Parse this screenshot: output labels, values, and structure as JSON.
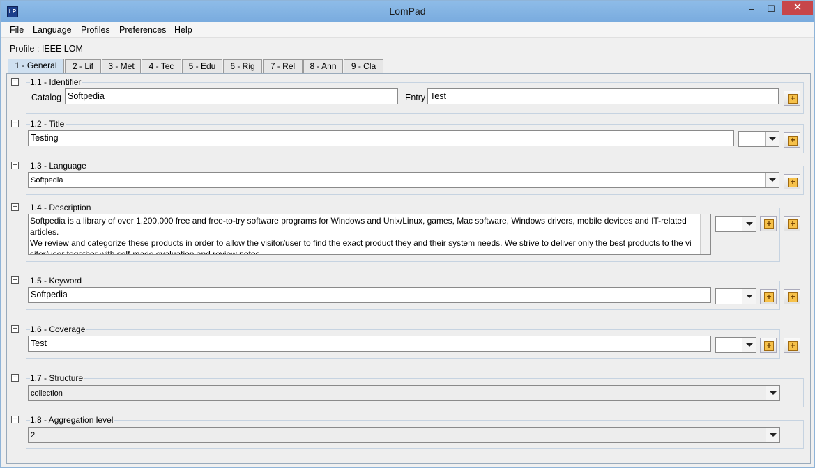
{
  "window": {
    "title": "LomPad",
    "icon": "app-logo-icon"
  },
  "menu": [
    "File",
    "Language",
    "Profiles",
    "Preferences",
    "Help"
  ],
  "profile": "Profile : IEEE LOM",
  "tabs": [
    "1 - General",
    "2 - Lif",
    "3 - Met",
    "4 - Tec",
    "5 - Edu",
    "6 - Rig",
    "7 - Rel",
    "8 - Ann",
    "9 - Cla"
  ],
  "sections": {
    "identifier": {
      "legend": "1.1 - Identifier",
      "catalog_label": "Catalog",
      "catalog_value": "Softpedia",
      "entry_label": "Entry",
      "entry_value": "Test"
    },
    "title": {
      "legend": "1.2 - Title",
      "value": "Testing"
    },
    "language": {
      "legend": "1.3 - Language",
      "value": "Softpedia"
    },
    "description": {
      "legend": "1.4 - Description",
      "line1": "Softpedia is a library of over 1,200,000 free and free-to-try software programs for Windows and Unix/Linux, games, Mac software, Windows drivers, mobile devices and IT-related",
      "line2": " articles.",
      "line3": "We review and categorize these products in order to allow the visitor/user to find the exact product they and their system needs. We strive to deliver only the best products to the vi",
      "line4": "sitor/user together with self-made evaluation and review notes."
    },
    "keyword": {
      "legend": "1.5 - Keyword",
      "value": "Softpedia"
    },
    "coverage": {
      "legend": "1.6 - Coverage",
      "value": "Test"
    },
    "structure": {
      "legend": "1.7 - Structure",
      "value": "collection"
    },
    "aggregation": {
      "legend": "1.8 - Aggregation level",
      "value": "2"
    }
  }
}
